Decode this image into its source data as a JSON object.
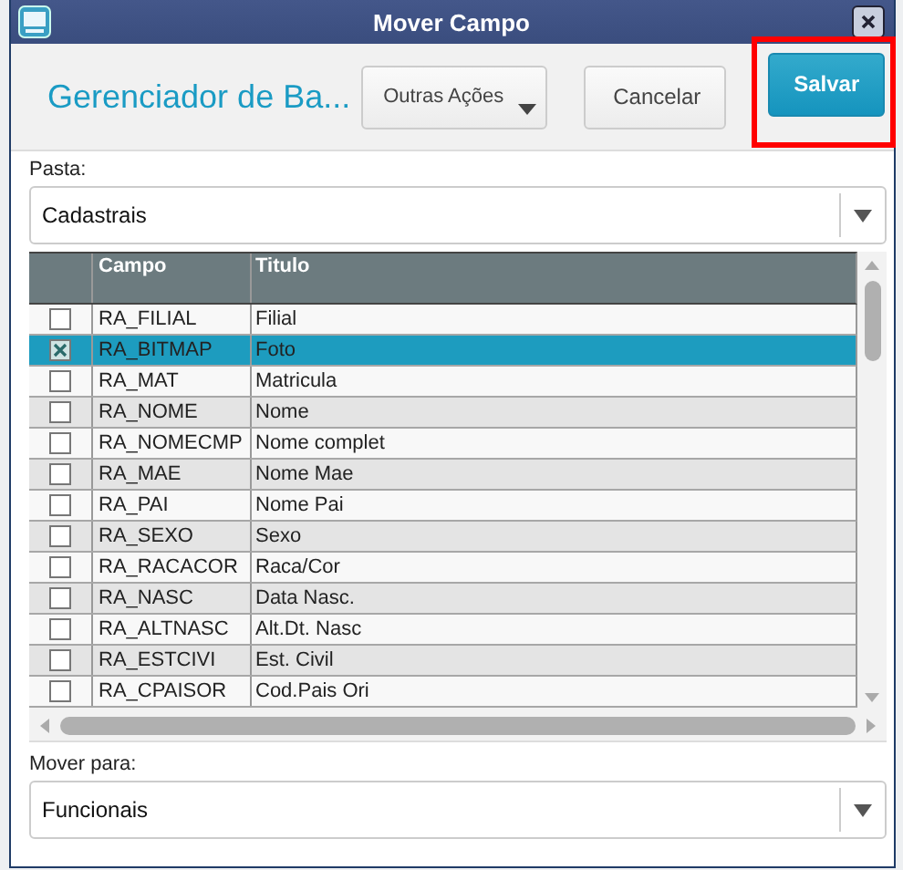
{
  "window": {
    "title": "Mover Campo"
  },
  "header": {
    "title": "Gerenciador de Ba...",
    "buttons": [
      {
        "label": "Outras Ações",
        "kind": "menu",
        "highlighted": false
      },
      {
        "label": "Cancelar",
        "kind": "plain",
        "highlighted": false
      },
      {
        "label": "Salvar",
        "kind": "primary",
        "highlighted": true
      }
    ]
  },
  "pasta": {
    "label": "Pasta:",
    "value": "Cadastrais"
  },
  "table": {
    "columns": [
      "Campo",
      "Titulo"
    ],
    "rows": [
      {
        "campo": "RA_FILIAL",
        "titulo": "Filial",
        "checked": false,
        "selected": false
      },
      {
        "campo": "RA_BITMAP",
        "titulo": "Foto",
        "checked": true,
        "selected": true
      },
      {
        "campo": "RA_MAT",
        "titulo": "Matricula",
        "checked": false,
        "selected": false
      },
      {
        "campo": "RA_NOME",
        "titulo": "Nome",
        "checked": false,
        "selected": false
      },
      {
        "campo": "RA_NOMECMP",
        "titulo": "Nome complet",
        "checked": false,
        "selected": false
      },
      {
        "campo": "RA_MAE",
        "titulo": "Nome Mae",
        "checked": false,
        "selected": false
      },
      {
        "campo": "RA_PAI",
        "titulo": "Nome Pai",
        "checked": false,
        "selected": false
      },
      {
        "campo": "RA_SEXO",
        "titulo": "Sexo",
        "checked": false,
        "selected": false
      },
      {
        "campo": "RA_RACACOR",
        "titulo": "Raca/Cor",
        "checked": false,
        "selected": false
      },
      {
        "campo": "RA_NASC",
        "titulo": "Data Nasc.",
        "checked": false,
        "selected": false
      },
      {
        "campo": "RA_ALTNASC",
        "titulo": "Alt.Dt. Nasc",
        "checked": false,
        "selected": false
      },
      {
        "campo": "RA_ESTCIVI",
        "titulo": "Est. Civil",
        "checked": false,
        "selected": false
      },
      {
        "campo": "RA_CPAISOR",
        "titulo": "Cod.Pais Ori",
        "checked": false,
        "selected": false
      }
    ]
  },
  "mover_para": {
    "label": "Mover para:",
    "value": "Funcionais"
  }
}
